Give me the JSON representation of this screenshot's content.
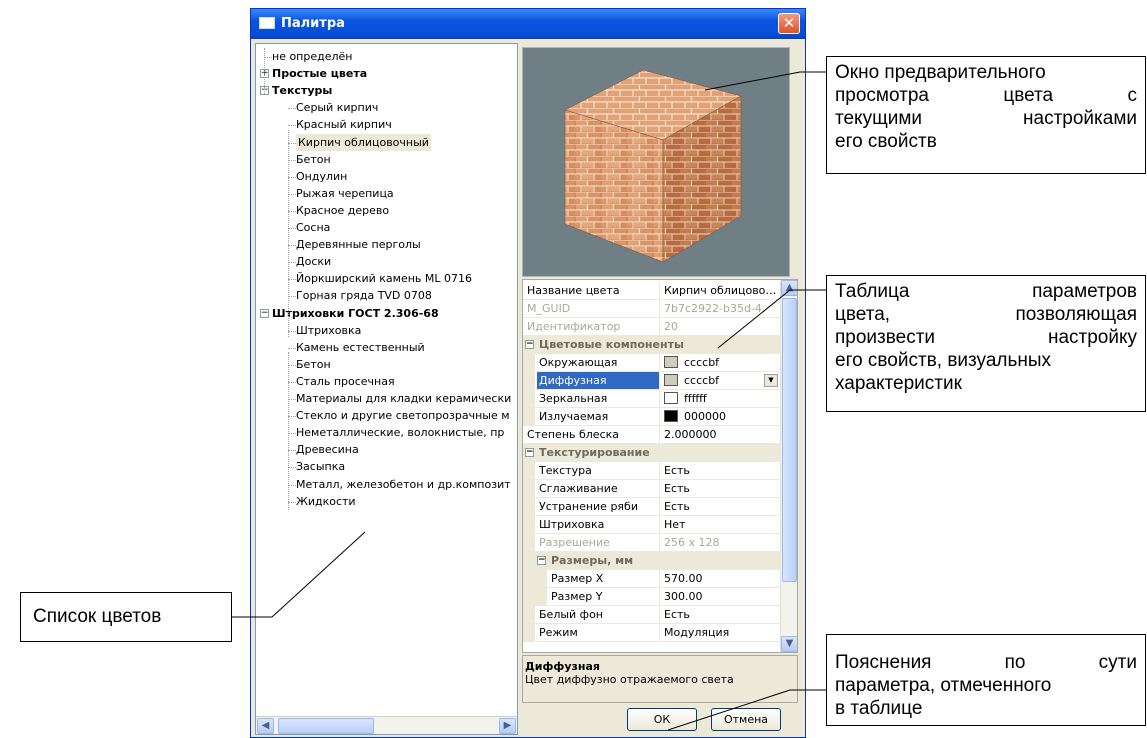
{
  "window": {
    "title": "Палитра",
    "close_glyph": "✕"
  },
  "tree": [
    {
      "label": "не определён",
      "level": 0,
      "bold": false
    },
    {
      "label": "Простые цвета",
      "level": 0,
      "bold": true,
      "expander": "+"
    },
    {
      "label": "Текстуры",
      "level": 0,
      "bold": true,
      "expander": "−"
    },
    {
      "label": "Серый кирпич",
      "level": 1
    },
    {
      "label": "Красный кирпич",
      "level": 1
    },
    {
      "label": "Кирпич облицовочный",
      "level": 1,
      "selected": true
    },
    {
      "label": "Бетон",
      "level": 1
    },
    {
      "label": "Ондулин",
      "level": 1
    },
    {
      "label": "Рыжая черепица",
      "level": 1
    },
    {
      "label": "Красное дерево",
      "level": 1
    },
    {
      "label": "Сосна",
      "level": 1
    },
    {
      "label": "Деревянные перголы",
      "level": 1
    },
    {
      "label": "Доски",
      "level": 1
    },
    {
      "label": "Йоркширский камень ML 0716",
      "level": 1
    },
    {
      "label": "Горная гряда TVD 0708",
      "level": 1
    },
    {
      "label": "Штриховки ГОСТ 2.306-68",
      "level": 0,
      "bold": true,
      "expander": "−"
    },
    {
      "label": "Штриховка",
      "level": 1
    },
    {
      "label": "Камень естественный",
      "level": 1
    },
    {
      "label": "Бетон",
      "level": 1
    },
    {
      "label": "Сталь просечная",
      "level": 1
    },
    {
      "label": "Материалы для кладки керамически",
      "level": 1
    },
    {
      "label": "Стекло и другие светопрозрачные м",
      "level": 1
    },
    {
      "label": "Неметаллические, волокнистые, пр",
      "level": 1
    },
    {
      "label": "Древесина",
      "level": 1
    },
    {
      "label": "Засыпка",
      "level": 1
    },
    {
      "label": "Металл, железобетон и др.композит",
      "level": 1
    },
    {
      "label": "Жидкости",
      "level": 1
    }
  ],
  "props": [
    {
      "type": "row",
      "label": "Название цвета",
      "value": "Кирпич облицово…",
      "indent": 0
    },
    {
      "type": "row",
      "label": "M_GUID",
      "value": "7b7c2922-b35d-4",
      "indent": 0,
      "disabled": true
    },
    {
      "type": "row",
      "label": "Идентификатор",
      "value": "20",
      "indent": 0,
      "disabled": true
    },
    {
      "type": "cat",
      "label": "Цветовые компоненты",
      "indent": 0
    },
    {
      "type": "row",
      "label": "Окружающая",
      "value": "ccccbf",
      "swatch": "#ccccbf",
      "indent": 1
    },
    {
      "type": "row",
      "label": "Диффузная",
      "value": "ccccbf",
      "swatch": "#ccccbf",
      "indent": 1,
      "highlighted": true,
      "dropdown": true
    },
    {
      "type": "row",
      "label": "Зеркальная",
      "value": "ffffff",
      "swatch": "#ffffff",
      "indent": 1
    },
    {
      "type": "row",
      "label": "Излучаемая",
      "value": "000000",
      "swatch": "#000000",
      "indent": 1
    },
    {
      "type": "row",
      "label": "Степень блеска",
      "value": "2.000000",
      "indent": 0
    },
    {
      "type": "cat",
      "label": "Текстурирование",
      "indent": 0
    },
    {
      "type": "row",
      "label": "Текстура",
      "value": "Есть",
      "indent": 1
    },
    {
      "type": "row",
      "label": "Сглаживание",
      "value": "Есть",
      "indent": 1
    },
    {
      "type": "row",
      "label": "Устранение ряби",
      "value": "Есть",
      "indent": 1
    },
    {
      "type": "row",
      "label": "Штриховка",
      "value": "Нет",
      "indent": 1
    },
    {
      "type": "row",
      "label": "Разрешение",
      "value": "256 x 128",
      "indent": 1,
      "disabled": true
    },
    {
      "type": "cat",
      "label": "Размеры, мм",
      "indent": 1
    },
    {
      "type": "row",
      "label": "Размер X",
      "value": "570.00",
      "indent": 2
    },
    {
      "type": "row",
      "label": "Размер Y",
      "value": "300.00",
      "indent": 2
    },
    {
      "type": "row",
      "label": "Белый фон",
      "value": "Есть",
      "indent": 1
    },
    {
      "type": "row",
      "label": "Режим",
      "value": "Модуляция",
      "indent": 1
    }
  ],
  "help": {
    "title": "Диффузная",
    "text": "Цвет диффузно отражаемого света"
  },
  "buttons": {
    "ok": "ОК",
    "cancel": "Отмена"
  },
  "annotations": {
    "preview": [
      "Окно предварительного",
      "просмотра цвета с",
      "текущими настройками",
      "его свойств"
    ],
    "table": [
      "Таблица параметров",
      "цвета, позволяющая",
      "произвести настройку",
      "его свойств, визуальных",
      "характеристик"
    ],
    "explain": [
      "Пояснения по сути",
      "параметра, отмеченного",
      "в таблице"
    ],
    "list": "Список цветов"
  },
  "colors": {
    "brick": "#c8804f",
    "mortar": "#e8d3b8",
    "preview_bg": "#6f7f85",
    "selection": "#316ac5"
  }
}
